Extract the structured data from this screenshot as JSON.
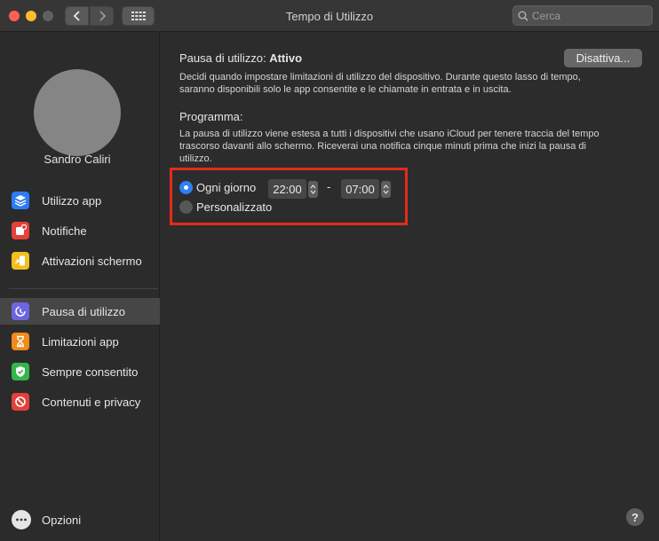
{
  "window": {
    "title": "Tempo di Utilizzo"
  },
  "search": {
    "placeholder": "Cerca"
  },
  "sidebar": {
    "user_name": "Sandro Caliri",
    "items": [
      {
        "label": "Utilizzo app",
        "icon": "layers-icon",
        "color": "#2c7cf6"
      },
      {
        "label": "Notifiche",
        "icon": "notification-icon",
        "color": "#e5403a"
      },
      {
        "label": "Attivazioni schermo",
        "icon": "pickup-icon",
        "color": "#f0c020"
      },
      {
        "label": "Pausa di utilizzo",
        "icon": "downtime-icon",
        "color": "#6d64e0",
        "selected": true
      },
      {
        "label": "Limitazioni app",
        "icon": "hourglass-icon",
        "color": "#f08a1c"
      },
      {
        "label": "Sempre consentito",
        "icon": "checkmark-shield-icon",
        "color": "#34b649"
      },
      {
        "label": "Contenuti e privacy",
        "icon": "no-entry-icon",
        "color": "#e5403a"
      }
    ],
    "options_label": "Opzioni"
  },
  "main": {
    "status_label": "Pausa di utilizzo:",
    "status_value": "Attivo",
    "deactivate_label": "Disattiva...",
    "status_description_line1": "Decidi quando impostare limitazioni di utilizzo del dispositivo. Durante questo lasso di tempo,",
    "status_description_line2": "saranno disponibili solo le app consentite e le chiamate in entrata e in uscita.",
    "schedule_title": "Programma:",
    "schedule_description_line1": "La pausa di utilizzo viene estesa a tutti i dispositivi che usano iCloud per tenere traccia del tempo",
    "schedule_description_line2": "trascorso davanti allo schermo. Riceverai una notifica cinque minuti prima che inizi la pausa di",
    "schedule_description_line3": "utilizzo.",
    "every_day_label": "Ogni giorno",
    "custom_label": "Personalizzato",
    "selected_option": "Ogni giorno",
    "start_time": "22:00",
    "time_separator": "-",
    "end_time": "07:00",
    "help_label": "?"
  },
  "colors": {
    "accent": "#2f7ff5",
    "highlight_box": "#e52a1f"
  }
}
